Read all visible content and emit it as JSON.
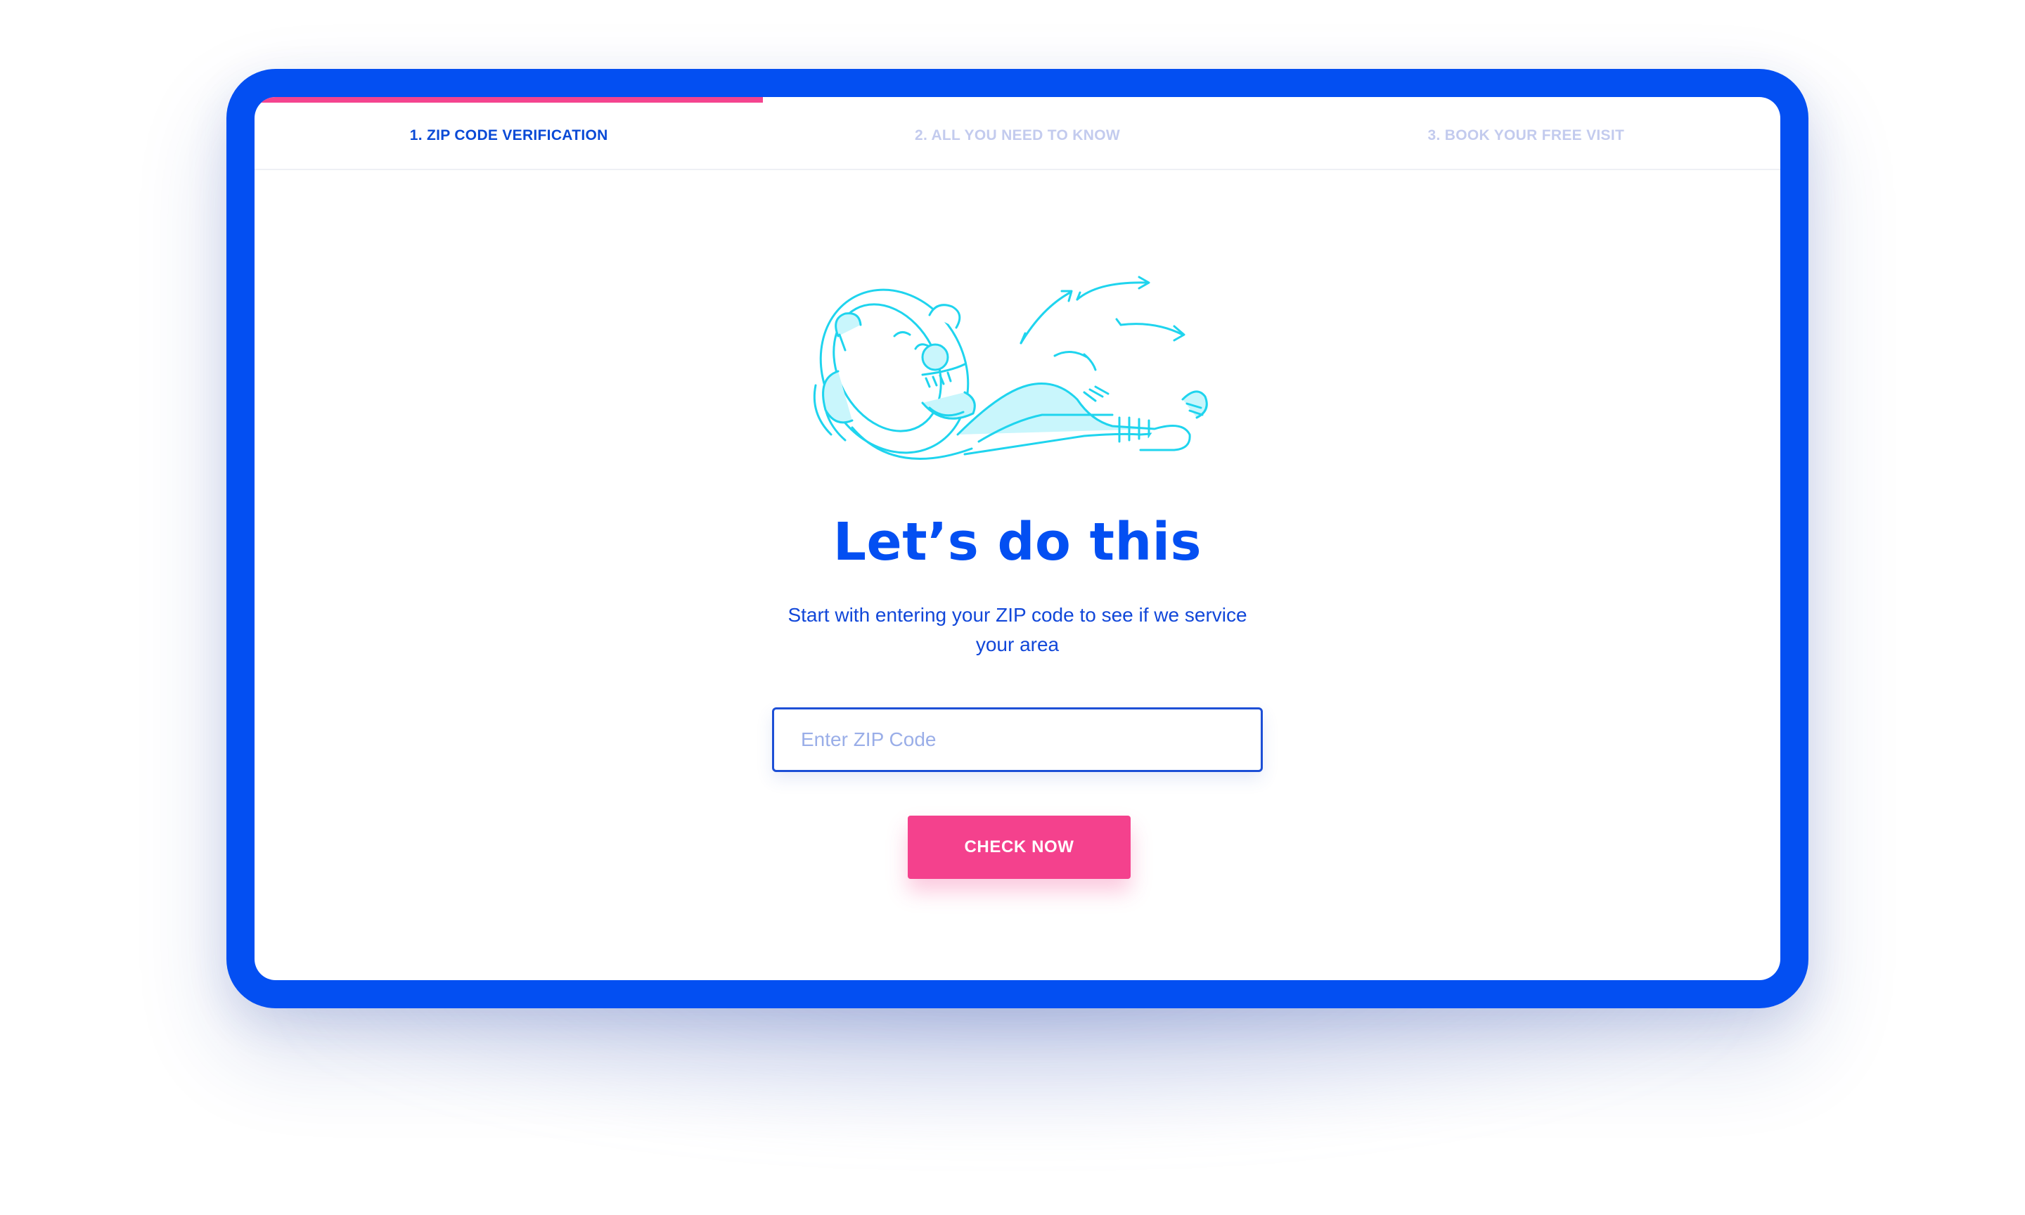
{
  "steps": [
    {
      "label": "1. ZIP CODE VERIFICATION",
      "active": true
    },
    {
      "label": "2. ALL YOU NEED TO KNOW",
      "active": false
    },
    {
      "label": "3. BOOK YOUR FREE VISIT",
      "active": false
    }
  ],
  "progress": {
    "fraction": 0.333,
    "color": "#f4448f"
  },
  "hero": {
    "title": "Let’s do this",
    "subtitle": "Start with entering your ZIP code to see if we service your area"
  },
  "zip_input": {
    "placeholder": "Enter ZIP Code",
    "value": ""
  },
  "check_button": {
    "label": "CHECK NOW"
  },
  "illustration": {
    "icon": "relaxing-character-illustration",
    "color": "#1fd4ee"
  },
  "colors": {
    "brand_blue": "#034ff2",
    "accent_pink": "#f4418d",
    "inactive_step": "#c3cbee"
  }
}
